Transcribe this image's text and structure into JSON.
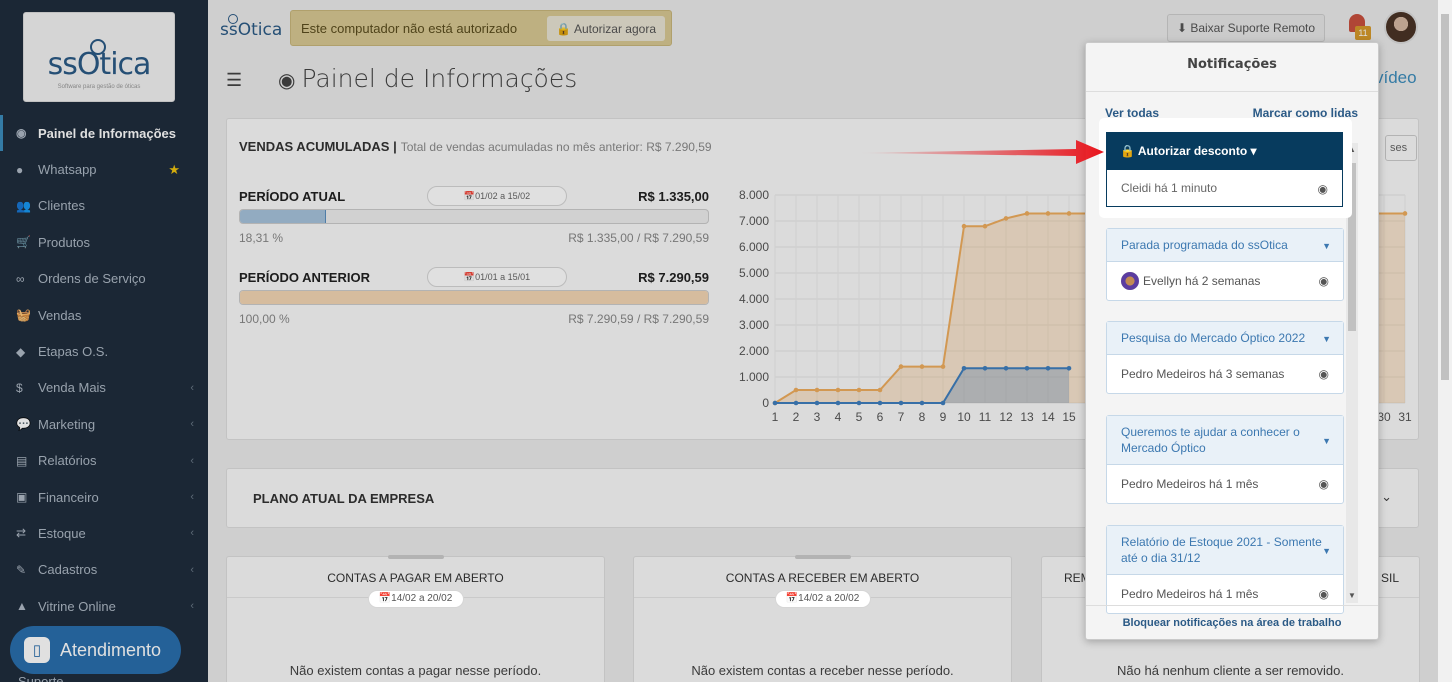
{
  "sidebar": {
    "logo_text": "ssOtica",
    "logo_sub": "Software para gestão de óticas",
    "items": [
      {
        "icon": "dashboard-icon",
        "glyph": "◉",
        "label": "Painel de Informações",
        "active": true
      },
      {
        "icon": "whatsapp-icon",
        "glyph": "●",
        "label": "Whatsapp",
        "star": "★"
      },
      {
        "icon": "users-icon",
        "glyph": "👥",
        "label": "Clientes"
      },
      {
        "icon": "cart-icon",
        "glyph": "🛒",
        "label": "Produtos"
      },
      {
        "icon": "glasses-icon",
        "glyph": "∞",
        "label": "Ordens de Serviço"
      },
      {
        "icon": "basket-icon",
        "glyph": "🧺",
        "label": "Vendas"
      },
      {
        "icon": "tags-icon",
        "glyph": "◆",
        "label": "Etapas O.S."
      },
      {
        "icon": "dollar-icon",
        "glyph": "$",
        "label": "Venda Mais",
        "chev": "‹"
      },
      {
        "icon": "comments-icon",
        "glyph": "💬",
        "label": "Marketing",
        "chev": "‹"
      },
      {
        "icon": "report-icon",
        "glyph": "▤",
        "label": "Relatórios",
        "chev": "‹"
      },
      {
        "icon": "money-icon",
        "glyph": "▣",
        "label": "Financeiro",
        "chev": "‹"
      },
      {
        "icon": "exchange-icon",
        "glyph": "⇄",
        "label": "Estoque",
        "chev": "‹"
      },
      {
        "icon": "edit-icon",
        "glyph": "✎",
        "label": "Cadastros",
        "chev": "‹"
      },
      {
        "icon": "store-icon",
        "glyph": "▲",
        "label": "Vitrine Online",
        "chev": "‹"
      }
    ],
    "atendimento": "Atendimento",
    "suporte": "Suporte"
  },
  "topbar": {
    "brand": "ssOtica",
    "warning": "Este computador não está autorizado",
    "authorize_btn": "🔒 Autorizar agora",
    "support_btn": "⬇ Baixar Suporte Remoto",
    "bell_count": "11"
  },
  "page": {
    "title": "Painel de Informações",
    "video_link": "vídeo"
  },
  "vendas": {
    "title": "VENDAS ACUMULADAS",
    "sep": "|",
    "subtitle": "Total de vendas acumuladas no mês anterior: R$ 7.290,59",
    "meses_btn": "ses",
    "atual": {
      "label": "PERÍODO ATUAL",
      "range": "📅01/02 a 15/02",
      "value": "R$ 1.335,00",
      "pct": "18,31 %",
      "ratio": "R$ 1.335,00 / R$ 7.290,59",
      "fill": 18.31,
      "color": "#a7c3dc",
      "border": "#5b8fbf"
    },
    "anterior": {
      "label": "PERÍODO ANTERIOR",
      "range": "📅01/01 a 15/01",
      "value": "R$ 7.290,59",
      "pct": "100,00 %",
      "ratio": "R$ 7.290,59 / R$ 7.290,59",
      "fill": 100,
      "color": "#f4d6b4",
      "border": "#e7b581"
    }
  },
  "chart_data": {
    "type": "area",
    "y_ticks": [
      "0",
      "1.000",
      "2.000",
      "3.000",
      "4.000",
      "5.000",
      "6.000",
      "7.000",
      "8.000"
    ],
    "ylim": [
      0,
      8000
    ],
    "x_ticks": [
      "1",
      "2",
      "3",
      "4",
      "5",
      "6",
      "7",
      "8",
      "9",
      "10",
      "11",
      "12",
      "13",
      "14",
      "15",
      "30",
      "31"
    ],
    "x_last_shown": 31,
    "series": [
      {
        "color": "#f0ad5e",
        "x": [
          1,
          2,
          3,
          4,
          5,
          6,
          7,
          8,
          9,
          10,
          11,
          12,
          13,
          14,
          15,
          16,
          17,
          31
        ],
        "values": [
          0,
          500,
          500,
          500,
          500,
          500,
          1400,
          1400,
          1400,
          6800,
          6800,
          7100,
          7290,
          7290,
          7290,
          7290,
          7290,
          7290
        ]
      },
      {
        "color": "#3f7fbf",
        "x": [
          1,
          2,
          3,
          4,
          5,
          6,
          7,
          8,
          9,
          10,
          11,
          12,
          13,
          14,
          15
        ],
        "values": [
          0,
          0,
          0,
          0,
          0,
          0,
          0,
          0,
          0,
          1335,
          1335,
          1335,
          1335,
          1335,
          1335
        ]
      }
    ]
  },
  "plano": {
    "title": "PLANO ATUAL DA EMPRESA",
    "chev": "⌄"
  },
  "summary": [
    {
      "title": "CONTAS A PAGAR EM ABERTO",
      "range": "📅14/02 a 20/02",
      "empty": "Não existem contas a pagar nesse período."
    },
    {
      "title": "CONTAS A RECEBER EM ABERTO",
      "range": "📅14/02 a 20/02",
      "empty": "Não existem contas a receber nesse período."
    },
    {
      "title": "REM",
      "title_right": "SIL",
      "empty": "Não há nenhum cliente a ser removido."
    }
  ],
  "notifications": {
    "title": "Notificações",
    "see_all": "Ver todas",
    "mark_read": "Marcar como lidas",
    "highlight": {
      "title": "🔒 Autorizar desconto ▾",
      "meta": "Cleidi há 1 minuto"
    },
    "items": [
      {
        "title": "Parada programada do ssOtica",
        "meta": "Evellyn há 2 semanas",
        "avatar": true
      },
      {
        "title": "Pesquisa do Mercado Óptico 2022",
        "meta": "Pedro Medeiros há 3 semanas"
      },
      {
        "title": "Queremos te ajudar a conhecer o Mercado Óptico",
        "meta": "Pedro Medeiros há 1 mês"
      },
      {
        "title": "Relatório de Estoque 2021 - Somente até o dia 31/12",
        "meta": "Pedro Medeiros há 1 mês"
      }
    ],
    "footer": "Bloquear notificações na área de trabalho",
    "eye": "👁",
    "dd": "▼"
  }
}
